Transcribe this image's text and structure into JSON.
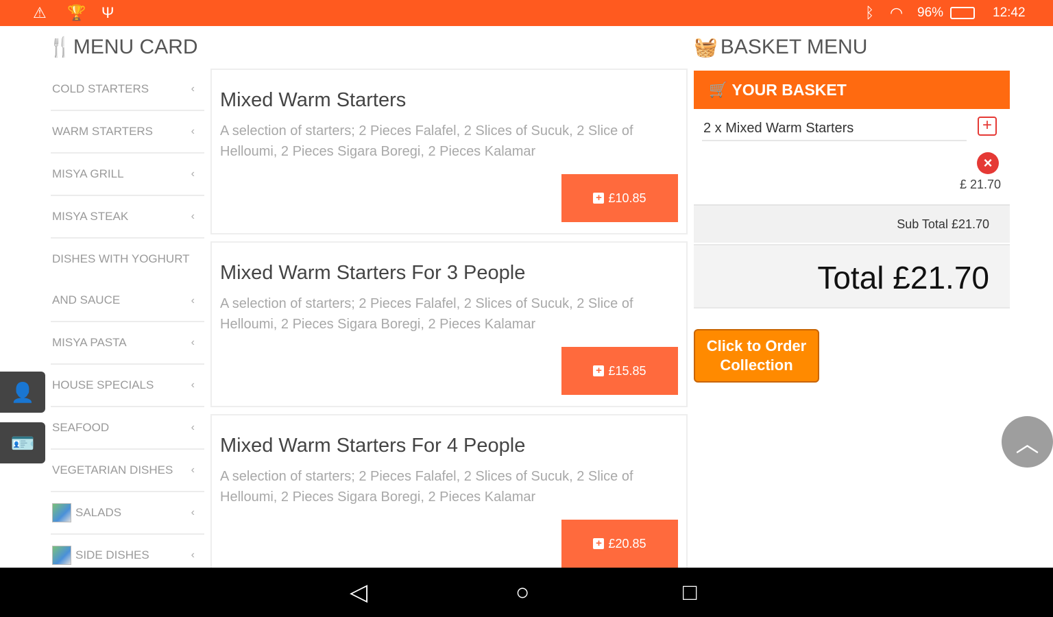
{
  "status_bar": {
    "battery": "96%",
    "time": "12:42",
    "icons": [
      "warning-icon",
      "trophy-icon",
      "usb-icon",
      "bluetooth-icon",
      "wifi-icon",
      "battery-icon"
    ]
  },
  "menu_card": {
    "heading": "MENU CARD",
    "categories": [
      {
        "label": "COLD STARTERS"
      },
      {
        "label": "WARM STARTERS"
      },
      {
        "label": "MISYA GRILL"
      },
      {
        "label": "MISYA STEAK"
      },
      {
        "label_line1": "DISHES WITH YOGHURT",
        "label_line2": "AND SAUCE"
      },
      {
        "label": "MISYA PASTA"
      },
      {
        "label": "HOUSE SPECIALS"
      },
      {
        "label": "SEAFOOD"
      },
      {
        "label": "VEGETARIAN DISHES"
      },
      {
        "label": "SALADS"
      },
      {
        "label": "SIDE DISHES"
      }
    ]
  },
  "dishes": [
    {
      "title": "Mixed Warm Starters",
      "description": "A selection of starters; 2 Pieces Falafel, 2 Slices of Sucuk, 2 Slice of Helloumi, 2 Pieces Sigara Boregi, 2 Pieces Kalamar",
      "price": "£10.85"
    },
    {
      "title": "Mixed Warm Starters For 3 People",
      "description": "A selection of starters; 2 Pieces Falafel, 2 Slices of Sucuk, 2 Slice of Helloumi, 2 Pieces Sigara Boregi, 2 Pieces Kalamar",
      "price": "£15.85"
    },
    {
      "title": "Mixed Warm Starters For 4 People",
      "description": "A selection of starters; 2 Pieces Falafel, 2 Slices of Sucuk, 2 Slice of Helloumi, 2 Pieces Sigara Boregi, 2 Pieces Kalamar",
      "price": "£20.85"
    }
  ],
  "basket": {
    "heading": "BASKET MENU",
    "bar_label": "YOUR BASKET",
    "items": [
      {
        "label": "2 x Mixed Warm Starters",
        "price": "£ 21.70"
      }
    ],
    "subtotal": "Sub Total £21.70",
    "total": "Total £21.70",
    "order_line1": "Click to Order",
    "order_line2": "Collection"
  },
  "colors": {
    "status_bar": "#ff5a1f",
    "basket_bar": "#ff6a10",
    "price_button": "#ff6a3d",
    "order_button": "#ff8a00",
    "remove": "#e53935"
  }
}
